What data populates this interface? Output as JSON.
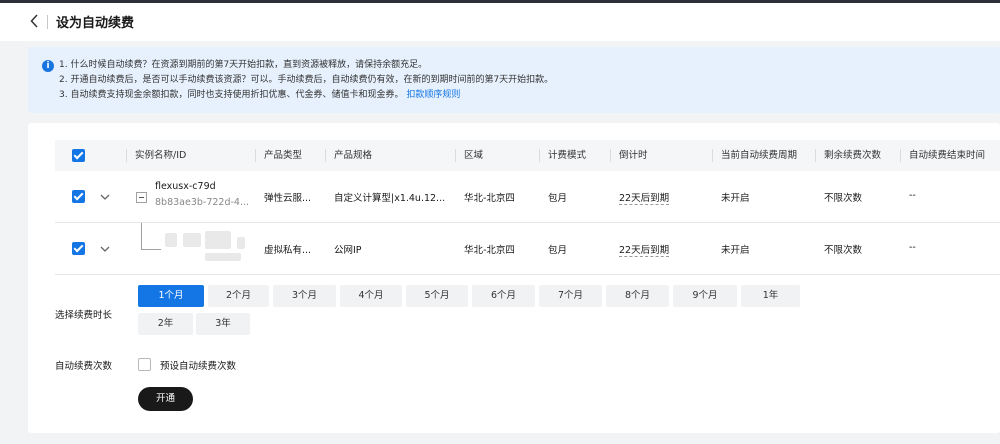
{
  "header": {
    "title": "设为自动续费"
  },
  "notice": {
    "line1": "1. 什么时候自动续费？在资源到期前的第7天开始扣款，直到资源被释放，请保持余额充足。",
    "line2": "2. 开通自动续费后，是否可以手动续费该资源？可以。手动续费后，自动续费仍有效，在新的到期时间前的第7天开始扣款。",
    "line3": "3. 自动续费支持现金余额扣款，同时也支持使用折扣优惠、代金券、储值卡和现金券。",
    "link": "扣款顺序规则"
  },
  "table": {
    "columns": [
      "实例名称/ID",
      "产品类型",
      "产品规格",
      "区域",
      "计费模式",
      "倒计时",
      "当前自动续费周期",
      "剩余续费次数",
      "自动续费结束时间"
    ],
    "rows": [
      {
        "name": "flexusx-c79d",
        "id": "8b83ae3b-722d-4...",
        "type": "弹性云服...",
        "spec": "自定义计算型|x1.4u.12...",
        "region": "华北-北京四",
        "billing": "包月",
        "countdown": "22天后到期",
        "cycle": "未开启",
        "remaining": "不限次数",
        "end": "--"
      },
      {
        "name": "",
        "id": "",
        "type": "虚拟私有...",
        "spec": "公网IP",
        "region": "华北-北京四",
        "billing": "包月",
        "countdown": "22天后到期",
        "cycle": "未开启",
        "remaining": "不限次数",
        "end": "--"
      }
    ]
  },
  "duration": {
    "label": "选择续费时长",
    "options": [
      "1个月",
      "2个月",
      "3个月",
      "4个月",
      "5个月",
      "6个月",
      "7个月",
      "8个月",
      "9个月",
      "1年",
      "2年",
      "3年"
    ],
    "selected": "1个月"
  },
  "renew_count": {
    "label": "自动续费次数",
    "checkbox_label": "预设自动续费次数",
    "checked": false
  },
  "submit": {
    "label": "开通"
  },
  "colors": {
    "primary": "#1476e5",
    "notice_bg": "#e6f1fd",
    "button_dark": "#191919"
  }
}
